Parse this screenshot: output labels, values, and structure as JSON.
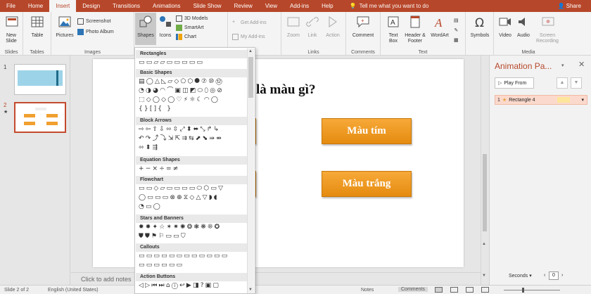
{
  "tabs": [
    "File",
    "Home",
    "Insert",
    "Design",
    "Transitions",
    "Animations",
    "Slide Show",
    "Review",
    "View",
    "Add-ins",
    "Help"
  ],
  "active_tab": "Insert",
  "tell_me": "Tell me what you want to do",
  "share": "Share",
  "ribbon": {
    "new_slide": "New Slide",
    "slides_group": "Slides",
    "table": "Table",
    "tables_group": "Tables",
    "pictures": "Pictures",
    "screenshot": "Screenshot",
    "photo_album": "Photo Album",
    "images_group": "Images",
    "shapes": "Shapes",
    "icons": "Icons",
    "models_3d": "3D Models",
    "smartart": "SmartArt",
    "chart": "Chart",
    "get_addins": "Get Add-ins",
    "my_addins": "My Add-ins",
    "zoom": "Zoom",
    "link": "Link",
    "action": "Action",
    "links_group": "Links",
    "comment": "Comment",
    "comments_group": "Comments",
    "text_box": "Text Box",
    "header_footer": "Header & Footer",
    "wordart": "WordArt",
    "text_group": "Text",
    "symbols": "Symbols",
    "video": "Video",
    "audio": "Audio",
    "screen_recording": "Screen Recording",
    "media_group": "Media"
  },
  "thumbnails": [
    {
      "num": "1"
    },
    {
      "num": "2",
      "star": "★"
    }
  ],
  "slide": {
    "question": "là màu gì?",
    "btn_top": "Màu tím",
    "btn_bottom": "Màu trắng"
  },
  "notes_placeholder": "Click to add notes",
  "animation_pane": {
    "title": "Animation Pa...",
    "play_from": "Play From",
    "item_num": "1",
    "item_name": "Rectangle 4",
    "seconds": "Seconds",
    "page": "0"
  },
  "shapes_menu": {
    "sections": [
      {
        "name": "Rectangles",
        "rows": [
          "▭▭▱▱▭▭▭▭▭"
        ]
      },
      {
        "name": "Basic Shapes",
        "rows": [
          "▤◯△◺▱◇⬠⬡⯃⑦⑩⑫",
          "◔◑◕◠⌒▣◫◩⬭⬯◎⊘",
          "⬚◇◯◇◯♡⚡☼☾◠◯",
          "{}[]{ }"
        ]
      },
      {
        "name": "Block Arrows",
        "rows": [
          "⇨⇦⇧⇩⬄⇳⤢⬍⬌⤡↱↳",
          "↶↷⤴⤵⇲⇱⇉⇆⬈⬊⇛⇴",
          "⬄⬍⇶"
        ]
      },
      {
        "name": "Equation Shapes",
        "rows": [
          "+−×÷=≠"
        ]
      },
      {
        "name": "Flowchart",
        "rows": [
          "▭▭◇▱▭▭▭▭⬭⬡▭▽",
          "◯▭▭▭⊗⊕⧖◇△▽◗◖",
          "◔▭◯"
        ]
      },
      {
        "name": "Stars and Banners",
        "rows": [
          "✹✸✦☆✶✷✺❂❃❋❊✪",
          "⛊⛊⚑⚐▭▭⛉"
        ]
      },
      {
        "name": "Callouts",
        "rows": [
          "▭▭▭▭▭▭▭▭▭▭▭▭",
          "▭▭▭▭▭▭"
        ]
      },
      {
        "name": "Action Buttons",
        "rows": [
          "◁▷⏮⏭⌂ⓘ↩▶◨?▣▢"
        ]
      }
    ]
  },
  "status": {
    "slide": "Slide 2 of 2",
    "language": "English (United States)",
    "notes": "Notes",
    "comments": "Comments"
  },
  "colors": {
    "accent": "#b7472a",
    "button": "#f29b1d"
  }
}
